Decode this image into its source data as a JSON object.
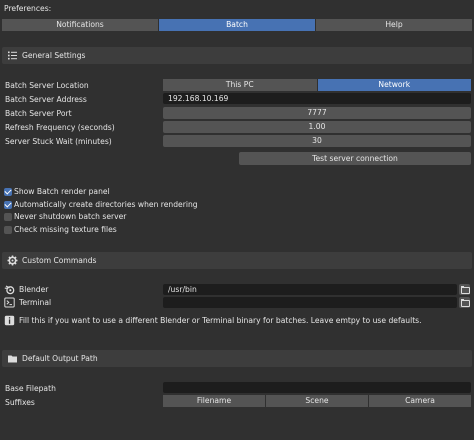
{
  "preferences_label": "Preferences:",
  "tabs": [
    {
      "label": "Notifications",
      "active": false
    },
    {
      "label": "Batch",
      "active": true
    },
    {
      "label": "Help",
      "active": false
    }
  ],
  "general": {
    "header": "General Settings",
    "location_label": "Batch Server Location",
    "location_options": [
      "This PC",
      "Network"
    ],
    "location_selected": "Network",
    "address_label": "Batch Server Address",
    "address_value": "192.168.10.169",
    "port_label": "Batch Server Port",
    "port_value": "7777",
    "refresh_label": "Refresh Frequency (seconds)",
    "refresh_value": "1.00",
    "stuck_label": "Server Stuck Wait (minutes)",
    "stuck_value": "30",
    "test_button": "Test server connection",
    "checkboxes": [
      {
        "label": "Show Batch render panel",
        "checked": true
      },
      {
        "label": "Automatically create directories when rendering",
        "checked": true
      },
      {
        "label": "Never shutdown batch server",
        "checked": false
      },
      {
        "label": "Check missing texture files",
        "checked": false
      }
    ]
  },
  "custom": {
    "header": "Custom Commands",
    "blender_label": "Blender",
    "blender_value": "/usr/bin",
    "terminal_label": "Terminal",
    "terminal_value": "",
    "info_text": "Fill this if you want to use a different Blender or Terminal binary for batches. Leave emtpy to use defaults."
  },
  "output": {
    "header": "Default Output Path",
    "base_label": "Base Filepath",
    "base_value": "",
    "suffixes_label": "Suffixes",
    "suffix_options": [
      "Filename",
      "Scene",
      "Camera"
    ]
  },
  "colors": {
    "background": "#303030",
    "accent": "#4772b3",
    "widget": "#545454",
    "field": "#1d1d1d",
    "panel_header": "#3d3d3d"
  }
}
